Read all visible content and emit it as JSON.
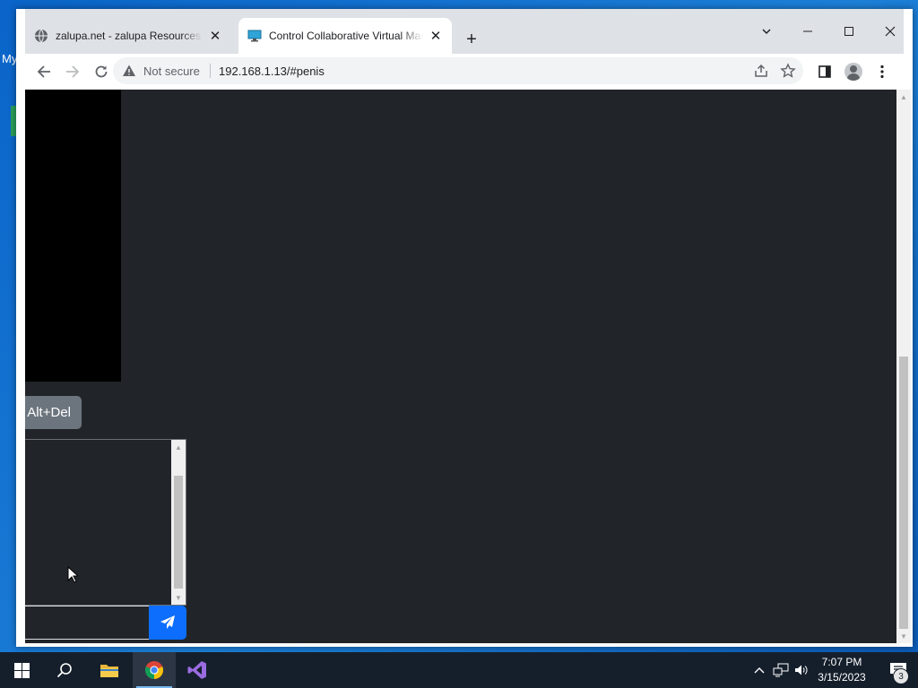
{
  "desktop": {
    "fragment_text": "My"
  },
  "browser": {
    "tabs": [
      {
        "title": "zalupa.net - zalupa Resources and",
        "favicon": "globe-icon",
        "active": false
      },
      {
        "title": "Control Collaborative Virtual Machine",
        "favicon": "monitor-icon",
        "active": true
      }
    ],
    "security_label": "Not secure",
    "url": "192.168.1.13/#penis"
  },
  "page": {
    "cad_button_label": "Alt+Del",
    "chat_input_value": "",
    "colors": {
      "background": "#212529",
      "send_button": "#0d6efd",
      "cad_button": "#6c757d"
    }
  },
  "taskbar": {
    "time": "7:07 PM",
    "date": "3/15/2023",
    "notification_count": "3",
    "pinned": [
      "windows-start-icon",
      "search-icon",
      "file-explorer-icon",
      "chrome-icon",
      "visual-studio-icon"
    ]
  }
}
